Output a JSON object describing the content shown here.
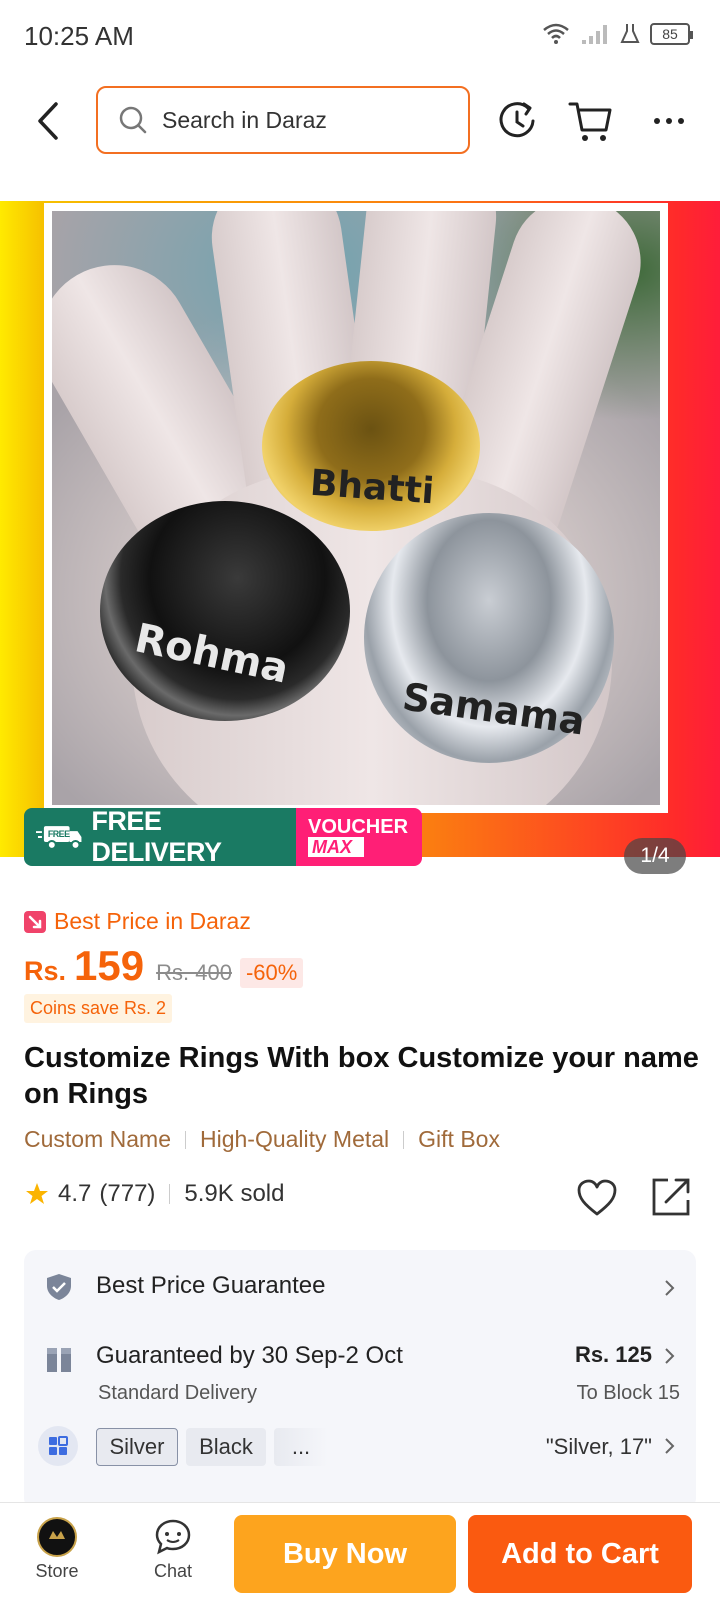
{
  "status_bar": {
    "time": "10:25 AM",
    "battery": "85"
  },
  "header": {
    "search_placeholder": "Search in Daraz",
    "icons": [
      "back-arrow-icon",
      "search-icon",
      "refresh-icon",
      "cart-icon",
      "more-icon"
    ]
  },
  "gallery": {
    "ring_names": [
      "Bhatti",
      "Rohma",
      "Samama"
    ],
    "badge_free": "FREE",
    "badge_delivery": "FREE DELIVERY",
    "badge_voucher": "VOUCHER",
    "badge_max": "MAX",
    "counter": "1/4"
  },
  "pricing": {
    "best_price": "Best Price in Daraz",
    "currency": "Rs.",
    "price": "159",
    "old_price": "Rs. 400",
    "discount": "-60%",
    "coins": "Coins save Rs. 2"
  },
  "product": {
    "title": "Customize Rings With box Customize your name on Rings",
    "tags": [
      "Custom Name",
      "High-Quality Metal",
      "Gift Box"
    ],
    "rating": "4.7",
    "reviews": "(777)",
    "sold": "5.9K sold"
  },
  "info": {
    "guarantee": "Best Price Guarantee",
    "delivery_title": "Guaranteed by 30 Sep-2 Oct",
    "delivery_sub": "Standard Delivery",
    "ship_price": "Rs. 125",
    "ship_to": "To Block 15",
    "variants": [
      "Silver",
      "Black",
      "..."
    ],
    "variant_value": "\"Silver, 17\""
  },
  "bottom": {
    "store": "Store",
    "chat": "Chat",
    "buy_now": "Buy Now",
    "add_to_cart": "Add to Cart"
  },
  "colors": {
    "accent": "#f5630a",
    "buy_now": "#fda41e",
    "add_to_cart": "#fa5a10",
    "free_delivery": "#1a7a63",
    "voucher": "#ff1f76"
  }
}
